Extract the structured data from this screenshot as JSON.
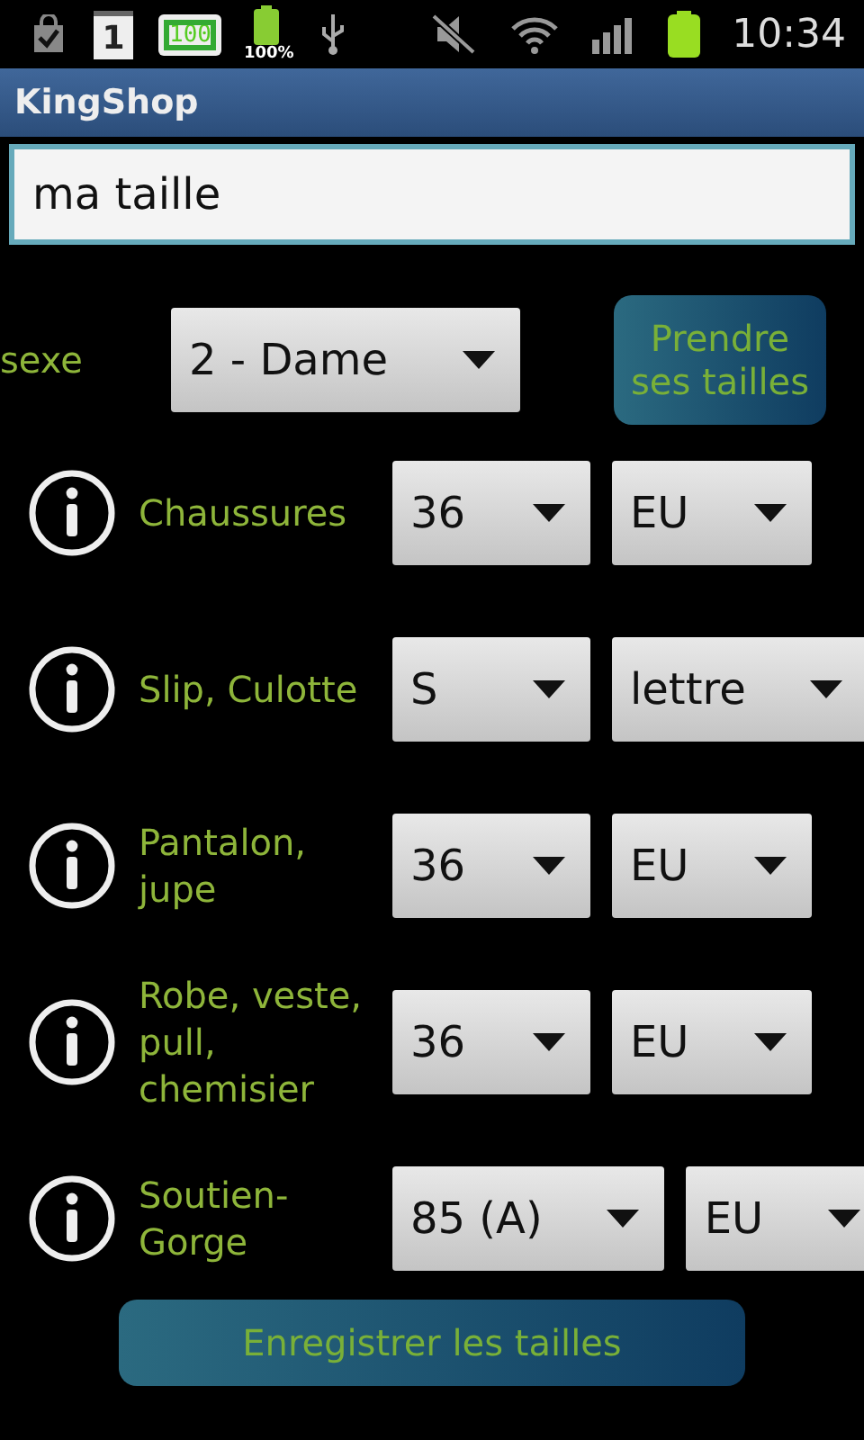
{
  "status_bar": {
    "calendar_day": "1",
    "battery_widget": "100",
    "battery_percent": "100%",
    "time": "10:34"
  },
  "window": {
    "title": "KingShop"
  },
  "search": {
    "value": "ma taille"
  },
  "sex": {
    "label": "sexe",
    "value": "2 - Dame"
  },
  "take_sizes_button": "Prendre ses tailles",
  "rows": [
    {
      "label": "Chaussures",
      "size": "36",
      "unit": "EU"
    },
    {
      "label": "Slip, Culotte",
      "size": "S",
      "unit": "lettre"
    },
    {
      "label": "Pantalon, jupe",
      "size": "36",
      "unit": "EU"
    },
    {
      "label": "Robe, veste, pull, chemisier",
      "size": "36",
      "unit": "EU"
    },
    {
      "label": "Soutien-Gorge",
      "size": "85 (A)",
      "unit": "EU"
    }
  ],
  "save_button": "Enregistrer les tailles"
}
